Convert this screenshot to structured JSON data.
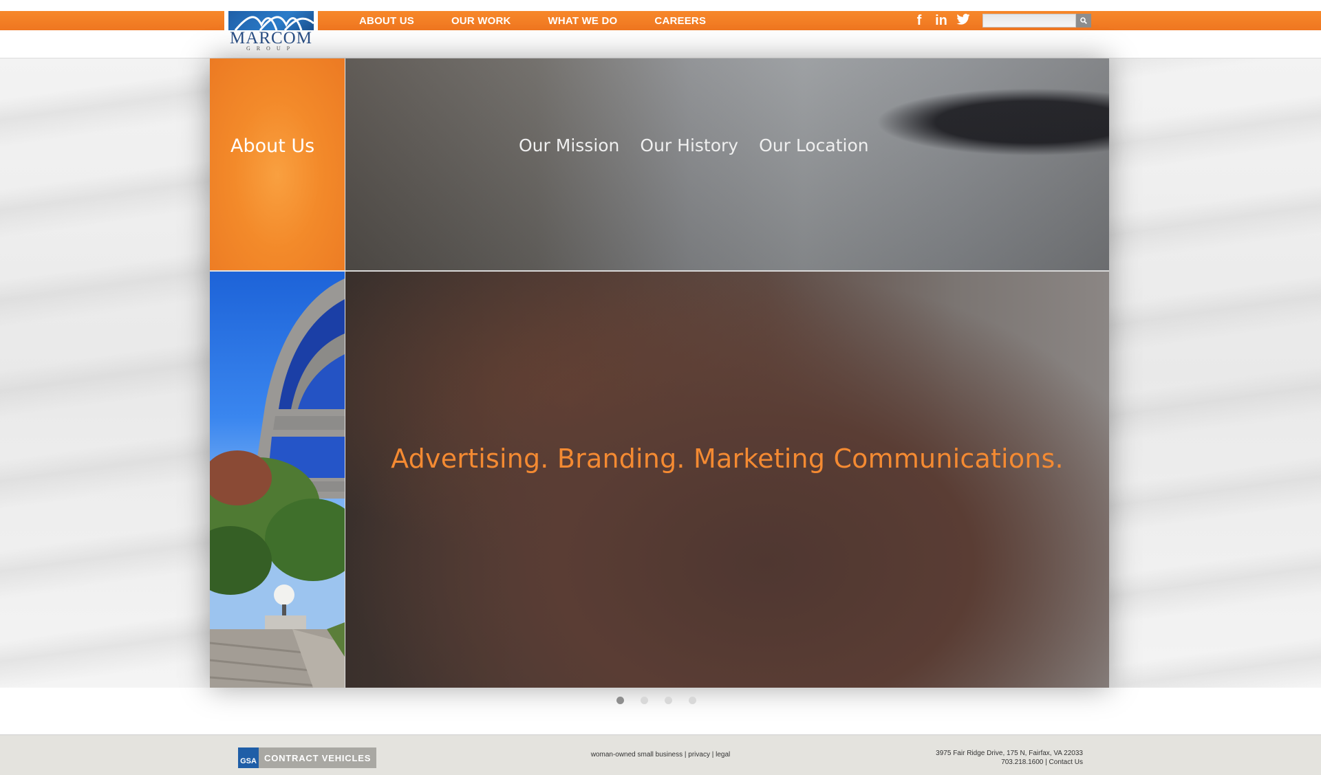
{
  "header": {
    "logo_name": "MARCOM",
    "logo_sub": "GROUP",
    "nav": [
      {
        "label": "ABOUT US"
      },
      {
        "label": "OUR WORK"
      },
      {
        "label": "WHAT WE DO"
      },
      {
        "label": "CAREERS"
      }
    ],
    "social": {
      "facebook": "f",
      "linkedin": "in"
    },
    "search": {
      "value": "",
      "placeholder": ""
    }
  },
  "main": {
    "section_title": "About Us",
    "subnav": [
      {
        "label": "Our Mission"
      },
      {
        "label": "Our History"
      },
      {
        "label": "Our Location"
      }
    ],
    "tagline": "Advertising. Branding. Marketing Communications."
  },
  "slider": {
    "count": 4,
    "active": 0
  },
  "footer": {
    "gsa_logo": "GSA",
    "gsa_label": "CONTRACT VEHICLES",
    "mid": {
      "woman_owned": "woman-owned small business",
      "privacy": "privacy",
      "legal": "legal"
    },
    "address": "3975 Fair Ridge Drive, 175 N, Fairfax, VA 22033",
    "phone": "703.218.1600",
    "contact": "Contact Us"
  },
  "colors": {
    "brand_orange": "#f48a32",
    "brand_blue": "#1f5fa8"
  }
}
